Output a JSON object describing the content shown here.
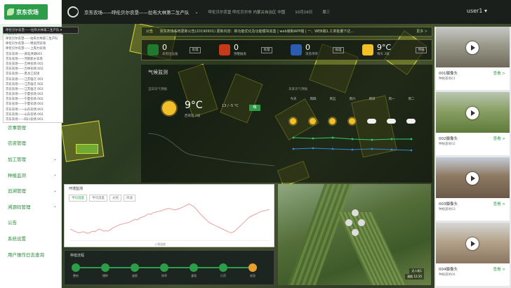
{
  "sidebar": {
    "logo": "京东农场",
    "items": [
      {
        "label": "首页",
        "active": true
      },
      {
        "label": "农场基础资料",
        "chevron": true
      },
      {
        "label": "地块管理",
        "sub": true
      },
      {
        "label": "作物管理",
        "sub": true
      },
      {
        "label": "设备管理",
        "sub": true
      },
      {
        "label": "监控智能",
        "chevron": true
      },
      {
        "label": "农事管理"
      },
      {
        "label": "农资管理"
      },
      {
        "label": "加工管理",
        "chevron": true
      },
      {
        "label": "种植监测",
        "chevron": true
      },
      {
        "label": "追溯管理",
        "chevron": true
      },
      {
        "label": "溯源码管理",
        "chevron": true
      },
      {
        "label": "公告"
      },
      {
        "label": "系统设置"
      },
      {
        "label": "用户操作日志查询"
      }
    ]
  },
  "topbar": {
    "farm": "京东农场——呼伦贝尔农垦——拉布大林第二生产队",
    "location": "呼伦贝尔农垦 呼伦贝尔市 内蒙古自治区 中国",
    "date": "10月16日",
    "weekday": "周三",
    "user": "user1"
  },
  "select": {
    "value": "呼伦贝尔农垦——拉布大林第二生产队"
  },
  "dropdown": {
    "options": [
      "呼伦贝尔农垦——拉布大林第二生产队",
      "呼伦贝尔农垦——特泥河农场",
      "呼伦贝尔农垦——上库力农场",
      "京东农场——湖北洪湖001",
      "京东农场——河南新乡农场",
      "京东农场——吉林农场 001",
      "京东农场——吉林农场 002",
      "京东农场——黑龙江农场",
      "京东农场——江苏宿迁 001",
      "京东农场——江苏宿迁 002",
      "京东农场——江苏宿迁 003",
      "京东农场——宁夏农场 001",
      "京东农场——宁夏农场 002",
      "京东农场——宁夏农场 003",
      "京东农场——山东农场 001",
      "京东农场——山东农场 002",
      "京东农场——四川农场 001"
    ]
  },
  "notice": {
    "label": "公告",
    "text": "京东农场系统更新公告(20190601) 更新内容：新功能优化及功能模块完善 | web端和APP端 | 一、WEB端1.工单批量下达...",
    "more": "更多 >"
  },
  "stats": [
    {
      "num": "0",
      "label": "未到位设备",
      "btn": "处理",
      "color": "#1f7a2f"
    },
    {
      "num": "0",
      "label": "预警触发",
      "btn": "处理",
      "color": "#c63a1a"
    },
    {
      "num": "0",
      "label": "消息待审",
      "btn": "处理",
      "color": "#2a5db0"
    },
    {
      "num": "9°C",
      "label": "晴天 2级",
      "btn": "预报",
      "color": "#f3c02a"
    }
  ],
  "weather": {
    "title": "气候监测",
    "sub": "当日天气预报",
    "temp": "9°C",
    "desc": "西南风 2级",
    "range": "13 / -5 °C",
    "badge": "晴",
    "forecast_title": "未来天气预报",
    "days": [
      "今天",
      "周四",
      "周五",
      "周六",
      "周日",
      "周一",
      "周二"
    ],
    "icons": [
      "sun",
      "sun",
      "sun",
      "sun",
      "cloud",
      "cloud",
      "cloud"
    ]
  },
  "chart": {
    "tabs": [
      "平均温度",
      "平均湿度",
      "光照",
      "风速"
    ],
    "title": "环境监测",
    "legend": "土壤温度"
  },
  "chart_data": {
    "type": "line",
    "y": [
      62,
      60,
      58,
      56,
      55,
      56,
      57,
      55,
      54,
      56,
      58,
      57,
      60,
      62,
      60,
      58,
      59,
      58,
      61,
      64,
      66,
      68,
      70,
      71,
      72,
      73,
      74,
      76,
      78,
      80,
      79,
      82,
      84,
      85,
      88,
      90,
      89,
      92,
      93,
      94,
      95,
      96,
      98,
      99,
      100,
      99,
      98,
      97,
      99,
      100,
      102,
      104,
      106,
      108,
      106,
      104,
      100,
      95,
      90,
      86,
      82,
      78,
      74,
      72,
      70,
      68,
      66,
      64,
      62,
      60,
      58,
      56,
      55,
      57,
      60,
      64,
      68,
      72,
      76,
      80,
      84,
      86,
      88,
      90,
      92,
      94,
      95,
      96,
      97,
      98
    ],
    "ylim": [
      40,
      110
    ]
  },
  "process": {
    "title": "种植流程",
    "steps": [
      "整地",
      "播种",
      "施肥",
      "除草",
      "灌溉",
      "打药",
      "收获"
    ]
  },
  "drone": {
    "labels": [
      "无人机1",
      "巡航 12:35"
    ]
  },
  "cameras": [
    {
      "name": "001摄像头",
      "sub": "种植基地01",
      "link": "查看 >",
      "colors": [
        "#c8c8c8",
        "#9a9a8a",
        "#6f6a5c"
      ]
    },
    {
      "name": "002摄像头",
      "sub": "种植基地02",
      "link": "查看 >",
      "colors": [
        "#b9c6b0",
        "#8aa065",
        "#5f7a3a"
      ]
    },
    {
      "name": "003摄像头",
      "sub": "种植基地03",
      "link": "查看 >",
      "colors": [
        "#c2cbd8",
        "#8f7a62",
        "#6a5a48"
      ]
    },
    {
      "name": "004摄像头",
      "sub": "种植基地04",
      "link": "查看 >",
      "colors": [
        "#d7d7d7",
        "#b5a48c",
        "#8a7560"
      ]
    }
  ]
}
